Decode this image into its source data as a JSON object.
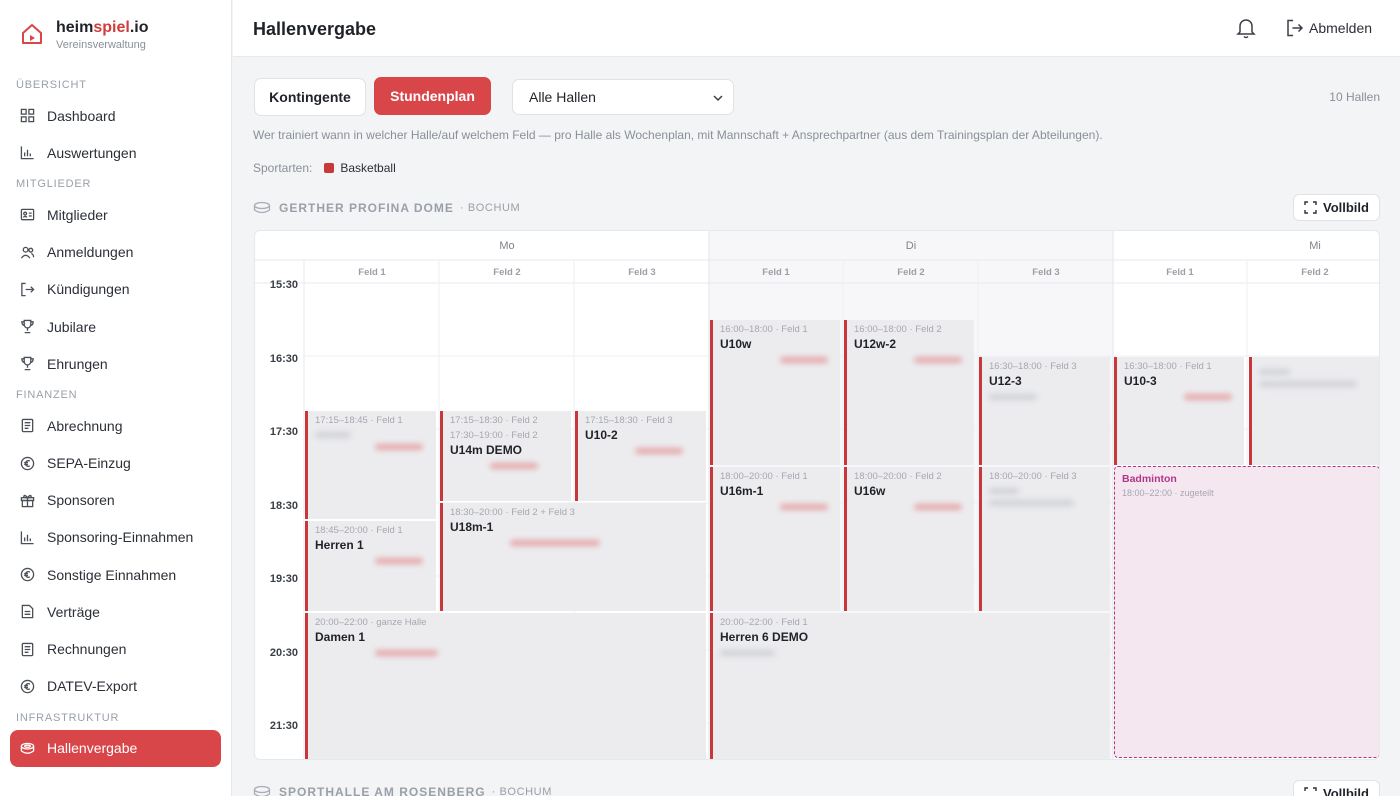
{
  "brand": {
    "name_a": "heim",
    "name_b": "spiel",
    "name_c": ".io",
    "subtitle": "Vereinsverwaltung"
  },
  "sidebar": {
    "sections": [
      {
        "label": "ÜBERSICHT",
        "items": [
          {
            "label": "Dashboard",
            "icon": "grid-icon"
          },
          {
            "label": "Auswertungen",
            "icon": "bar-chart-icon"
          }
        ]
      },
      {
        "label": "MITGLIEDER",
        "items": [
          {
            "label": "Mitglieder",
            "icon": "id-card-icon"
          },
          {
            "label": "Anmeldungen",
            "icon": "users-icon"
          },
          {
            "label": "Kündigungen",
            "icon": "logout-arrow-icon"
          },
          {
            "label": "Jubilare",
            "icon": "trophy-icon"
          },
          {
            "label": "Ehrungen",
            "icon": "trophy-icon"
          }
        ]
      },
      {
        "label": "FINANZEN",
        "items": [
          {
            "label": "Abrechnung",
            "icon": "document-icon"
          },
          {
            "label": "SEPA-Einzug",
            "icon": "euro-icon"
          },
          {
            "label": "Sponsoren",
            "icon": "gift-icon"
          },
          {
            "label": "Sponsoring-Einnahmen",
            "icon": "bar-chart-icon"
          },
          {
            "label": "Sonstige Einnahmen",
            "icon": "euro-icon"
          },
          {
            "label": "Verträge",
            "icon": "document-icon"
          },
          {
            "label": "Rechnungen",
            "icon": "document-icon"
          },
          {
            "label": "DATEV-Export",
            "icon": "euro-icon"
          }
        ]
      },
      {
        "label": "INFRASTRUKTUR",
        "items": [
          {
            "label": "Hallenvergabe",
            "icon": "stadium-icon",
            "active": true
          }
        ]
      }
    ]
  },
  "header": {
    "title": "Hallenvergabe",
    "logout_label": "Abmelden"
  },
  "toolbar": {
    "tab_kontingente": "Kontingente",
    "tab_stundenplan": "Stundenplan",
    "hall_select": "Alle Hallen",
    "hall_count": "10 Hallen"
  },
  "description": "Wer trainiert wann in welcher Halle/auf welchem Feld — pro Halle als Wochenplan, mit Mannschaft + Ansprechpartner (aus dem Trainingsplan der Abteilungen).",
  "sports": {
    "label": "Sportarten:",
    "items": [
      "Basketball"
    ],
    "color": "#c83a3a"
  },
  "halls": [
    {
      "name": "GERTHER PROFINA DOME",
      "city": "BOCHUM",
      "fullscreen_label": "Vollbild"
    },
    {
      "name": "SPORTHALLE AM ROSENBERG",
      "city": "BOCHUM",
      "fullscreen_label": "Vollbild"
    }
  ],
  "schedule": {
    "days": [
      "Mo",
      "Di",
      "Mi"
    ],
    "fields": [
      "Feld 1",
      "Feld 2",
      "Feld 3",
      "Feld 1",
      "Feld 2",
      "Feld 3",
      "Feld 1",
      "Feld 2"
    ],
    "times": [
      "15:30",
      "16:30",
      "17:30",
      "18:30",
      "19:30",
      "20:30",
      "21:30"
    ],
    "events": [
      {
        "time": "17:15–18:45 · Feld 1",
        "name": ""
      },
      {
        "time": "17:15–18:30 · Feld 2",
        "name": ""
      },
      {
        "time": "17:30–19:00 · Feld 2",
        "name": "U14m DEMO"
      },
      {
        "time": "17:15–18:30 · Feld 3",
        "name": "U10-2"
      },
      {
        "time": "18:30–20:00 · Feld 2 + Feld 3",
        "name": "U18m-1"
      },
      {
        "time": "18:45–20:00 · Feld 1",
        "name": "Herren 1"
      },
      {
        "time": "20:00–22:00 · ganze Halle",
        "name": "Damen 1"
      },
      {
        "time": "16:00–18:00 · Feld 1",
        "name": "U10w"
      },
      {
        "time": "16:00–18:00 · Feld 2",
        "name": "U12w-2"
      },
      {
        "time": "16:30–18:00 · Feld 3",
        "name": "U12-3"
      },
      {
        "time": "18:00–20:00 · Feld 1",
        "name": "U16m-1"
      },
      {
        "time": "18:00–20:00 · Feld 2",
        "name": "U16w"
      },
      {
        "time": "18:00–20:00 · Feld 3",
        "name": ""
      },
      {
        "time": "20:00–22:00 · Feld 1",
        "name": "Herren 6 DEMO"
      },
      {
        "time": "16:30–18:00 · Feld 1",
        "name": "U10-3"
      }
    ],
    "allocation": {
      "name": "Badminton",
      "time": "18:00–22:00 · zugeteilt",
      "color": "#b0368a"
    }
  },
  "colors": {
    "accent": "#d9464a",
    "event_border": "#c8373b",
    "event_bg": "#ececef"
  }
}
